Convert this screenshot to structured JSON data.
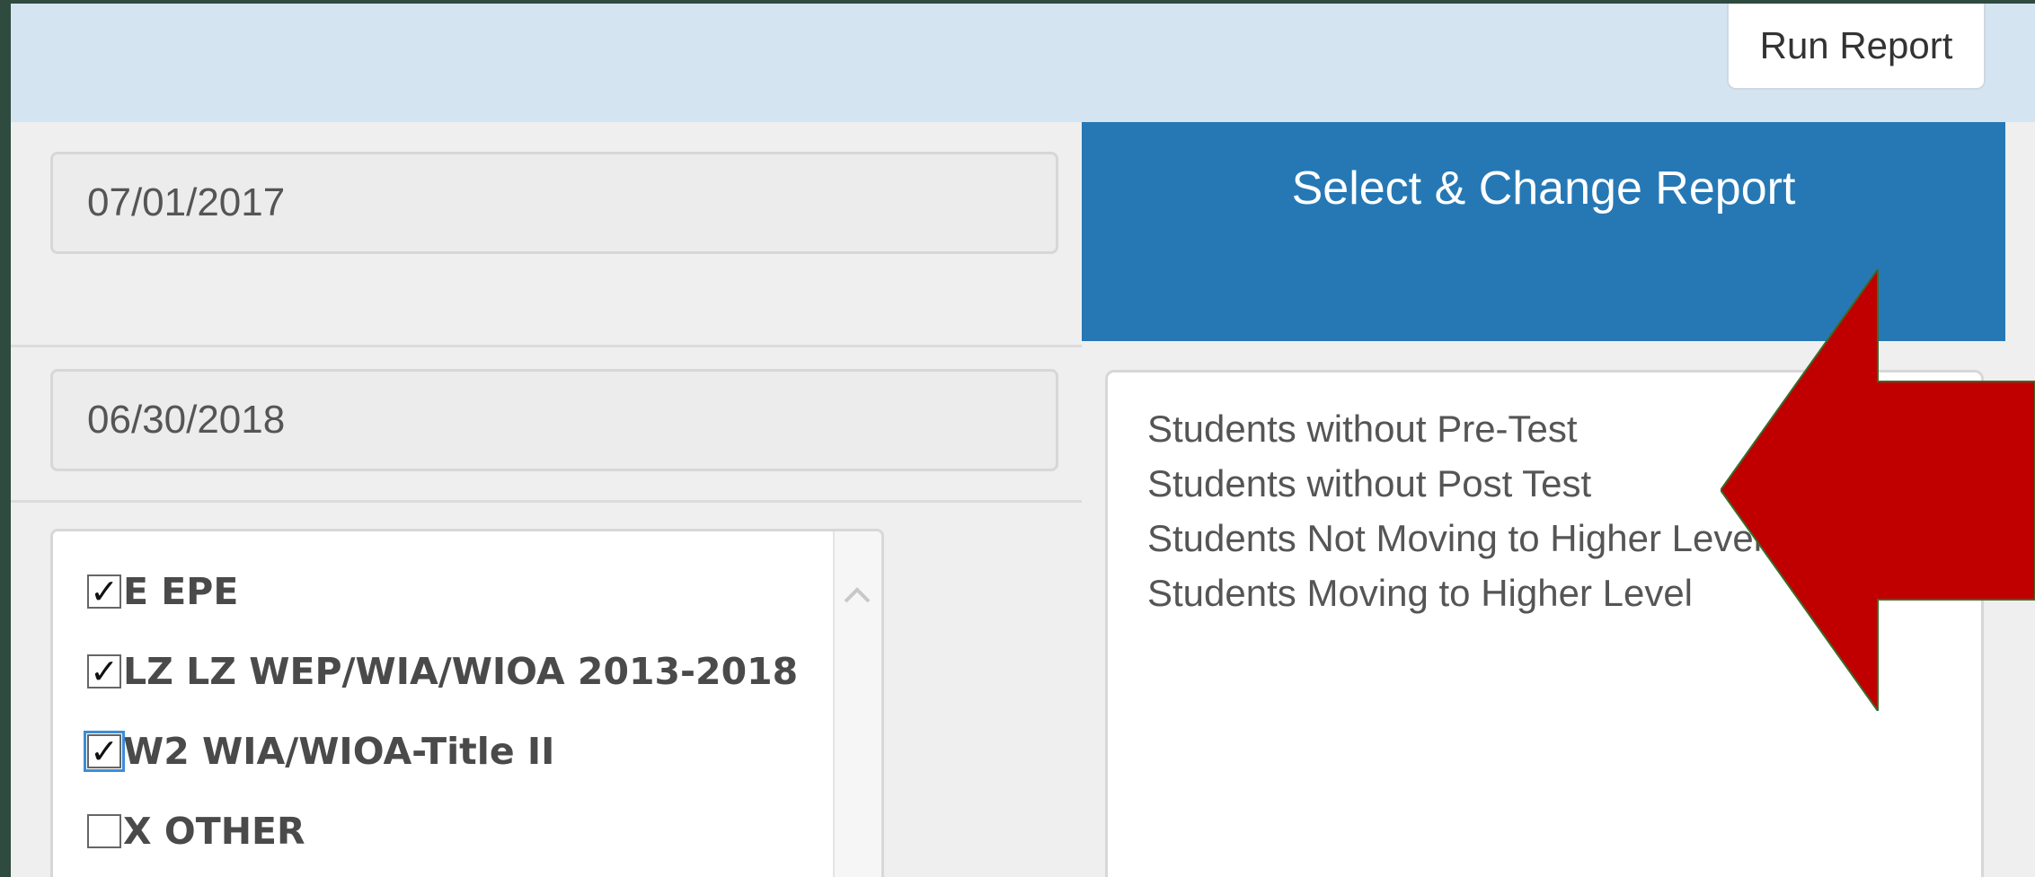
{
  "toolbar": {
    "run_report_label": "Run Report"
  },
  "filters": {
    "start_date": "07/01/2017",
    "end_date": "06/30/2018"
  },
  "report_panel": {
    "header": "Select & Change Report",
    "items": [
      "Students without Pre-Test",
      "Students without Post Test",
      "Students Not Moving to Higher Level",
      "Students Moving to Higher Level"
    ]
  },
  "programs": [
    {
      "label": "E EPE",
      "checked": true,
      "mark": "✓"
    },
    {
      "label": "LZ LZ WEP/WIA/WIOA 2013-2018",
      "checked": true,
      "mark": "✓"
    },
    {
      "label": "W2 WIA/WIOA-Title II",
      "checked": true,
      "mark": "✓"
    },
    {
      "label": "X OTHER",
      "checked": false,
      "mark": ""
    }
  ],
  "annotation": {
    "arrow_color": "#c00000",
    "arrow_icon": "left-arrow-icon"
  }
}
